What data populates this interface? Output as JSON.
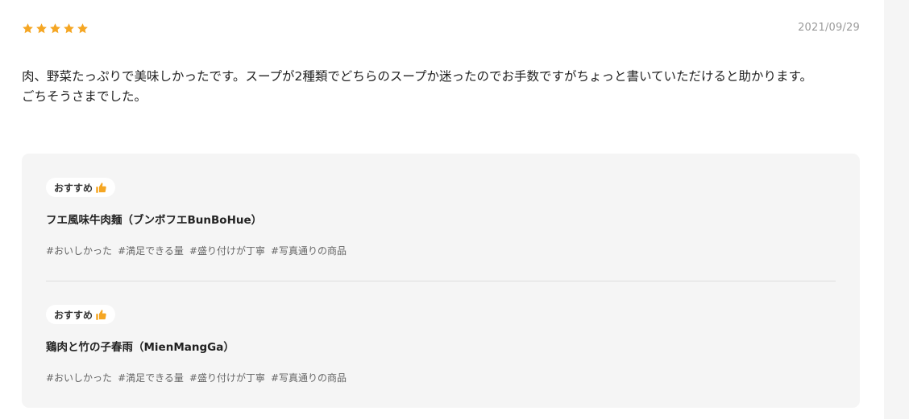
{
  "review": {
    "rating": 5,
    "date": "2021/09/29",
    "text_lines": [
      "肉、野菜たっぷりで美味しかったです。スープが2種類でどちらのスープか迷ったのでお手数ですがちょっと書いていただけると助かります。",
      "ごちそうさまでした。"
    ],
    "colors": {
      "star": "#f5a623",
      "thumb": "#f5a623",
      "panel": "#f5f5f5"
    }
  },
  "dishes": [
    {
      "badge": "おすすめ",
      "badge_icon": "thumbs-up-icon",
      "name": "フエ風味牛肉麺（ブンボフエBunBoHue）",
      "tags": [
        "#おいしかった",
        "#満足できる量",
        "#盛り付けが丁寧",
        "#写真通りの商品"
      ]
    },
    {
      "badge": "おすすめ",
      "badge_icon": "thumbs-up-icon",
      "name": "鶏肉と竹の子春雨（MienMangGa）",
      "tags": [
        "#おいしかった",
        "#満足できる量",
        "#盛り付けが丁寧",
        "#写真通りの商品"
      ]
    }
  ]
}
